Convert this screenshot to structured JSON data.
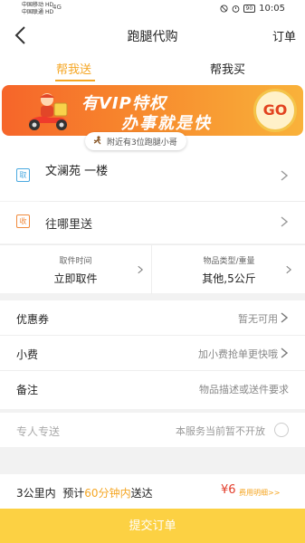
{
  "status_bar": {
    "carrier_1": "中国移动",
    "carrier_2": "中国联通",
    "carrier_1_badge": "HD",
    "carrier_2_badge": "HD",
    "network": "4G",
    "battery": "90",
    "time": "10:05"
  },
  "nav": {
    "title": "跑腿代购",
    "action": "订单"
  },
  "tabs": [
    {
      "label": "帮我送",
      "active": true
    },
    {
      "label": "帮我买",
      "active": false
    }
  ],
  "banner": {
    "headline_prefix": "有",
    "headline_vip": "VIP",
    "headline_suffix": "特权",
    "slogan": "办事就是快",
    "go_label": "GO",
    "nearby_text": "附近有3位跑腿小哥"
  },
  "pickup_address": {
    "tag": "取",
    "text": "文澜苑 一楼"
  },
  "delivery_address": {
    "tag": "收",
    "text": "往哪里送"
  },
  "pickup_time": {
    "label": "取件时间",
    "value": "立即取件"
  },
  "item_type": {
    "label": "物品类型/重量",
    "value": "其他,5公斤"
  },
  "options": {
    "coupon": {
      "label": "优惠券",
      "value": "暂无可用"
    },
    "tip": {
      "label": "小费",
      "value": "加小费抢单更快哦"
    },
    "note": {
      "label": "备注",
      "value": "物品描述或送件要求"
    }
  },
  "private_delivery": {
    "label": "专人专送",
    "value": "本服务当前暂不开放",
    "enabled": false
  },
  "summary": {
    "distance": "3公里内",
    "estimate_prefix": "预计",
    "estimate_highlight": "60分钟内",
    "estimate_suffix": "送达",
    "price": "¥6",
    "detail_link": "费用明细>>"
  },
  "submit_label": "提交订单",
  "colors": {
    "accent": "#f5a623",
    "submit_bg": "#fcd143",
    "price": "#e23c2a",
    "pickup_tag": "#4aa9e0",
    "delivery_tag": "#f08a3c"
  }
}
